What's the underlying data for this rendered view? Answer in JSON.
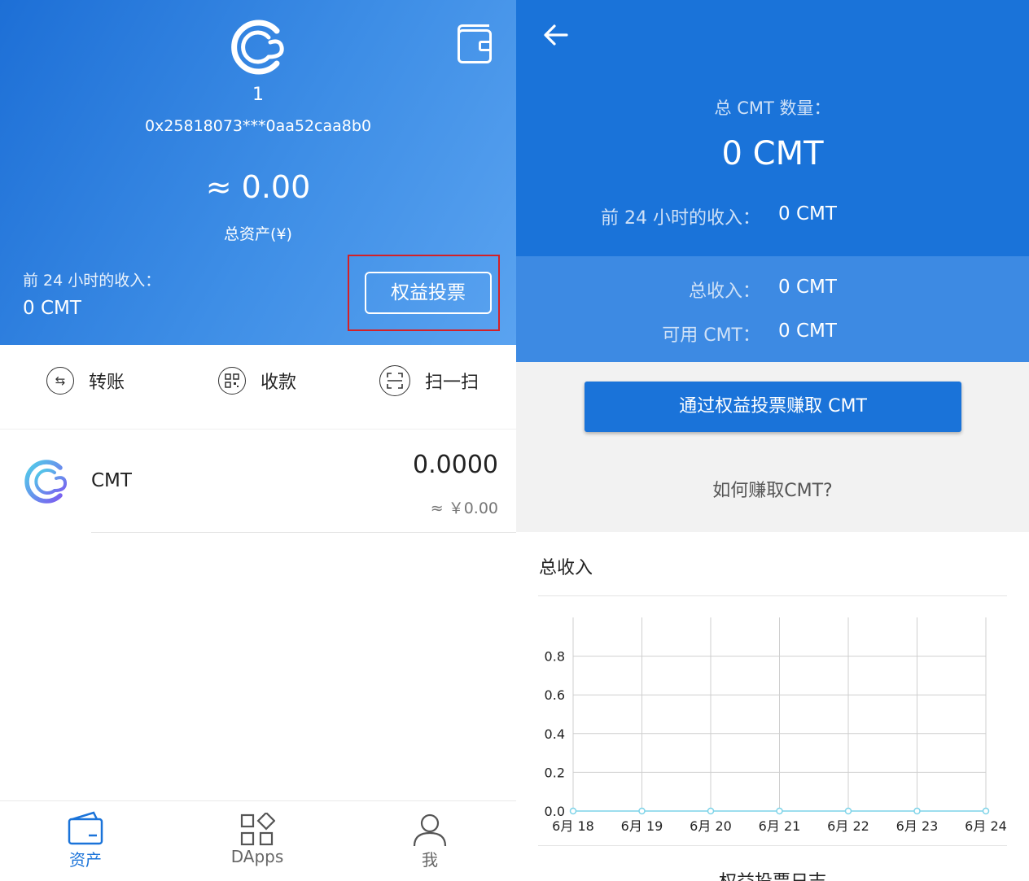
{
  "left": {
    "wallet_name": "1",
    "address": "0x25818073***0aa52caa8b0",
    "total_assets_value": "≈ 0.00",
    "total_assets_label": "总资产(¥)",
    "income_24h_label": "前 24 小时的收入：",
    "income_24h_value": "0 CMT",
    "vote_button": "权益投票",
    "actions": [
      {
        "label": "转账",
        "icon": "transfer-icon"
      },
      {
        "label": "收款",
        "icon": "qr-code-icon"
      },
      {
        "label": "扫一扫",
        "icon": "scan-icon"
      }
    ],
    "token": {
      "name": "CMT",
      "amount": "0.0000",
      "fiat": "≈ ￥0.00"
    },
    "nav": [
      {
        "label": "资产",
        "icon": "wallet-icon",
        "active": true
      },
      {
        "label": "DApps",
        "icon": "apps-icon",
        "active": false
      },
      {
        "label": "我",
        "icon": "person-icon",
        "active": false
      }
    ]
  },
  "right": {
    "total_label": "总 CMT 数量：",
    "total_value": "0 CMT",
    "income_24h_label": "前 24 小时的收入：",
    "income_24h_value": "0 CMT",
    "total_income_label": "总收入：",
    "total_income_value": "0 CMT",
    "available_label": "可用 CMT：",
    "available_value": "0 CMT",
    "earn_button": "通过权益投票赚取 CMT",
    "how_to": "如何赚取CMT?",
    "chart_title": "总收入",
    "footer_partial": "权益投票日志"
  },
  "colors": {
    "primary": "#1a73d9",
    "header_light": "#3d8ae3",
    "highlight": "#d32027",
    "chart_line": "#7dd3e8"
  },
  "chart_data": {
    "type": "line",
    "title": "",
    "categories": [
      "6月 18",
      "6月 19",
      "6月 20",
      "6月 21",
      "6月 22",
      "6月 23",
      "6月 24"
    ],
    "yticks": [
      "0.0",
      "0.2",
      "0.4",
      "0.6",
      "0.8"
    ],
    "series": [
      {
        "values": [
          0,
          0,
          0,
          0,
          0,
          0,
          0
        ]
      }
    ],
    "ylim": [
      0,
      1.0
    ],
    "grid": true
  }
}
